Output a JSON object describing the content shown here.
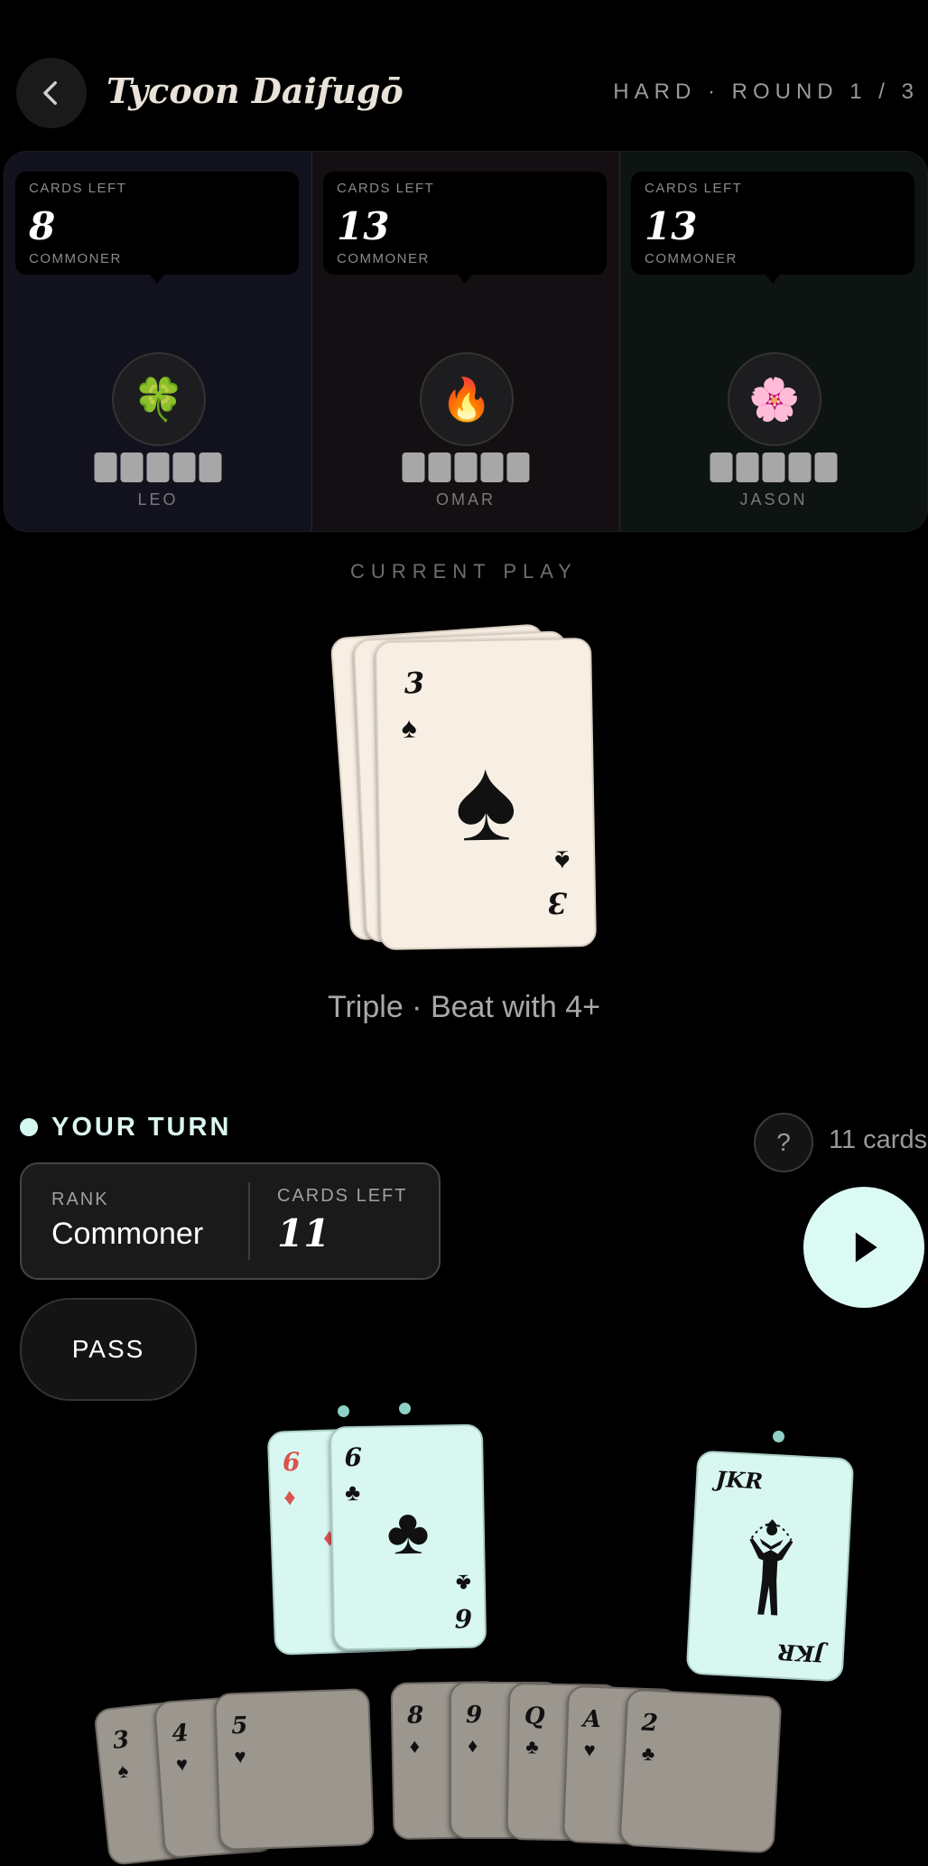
{
  "header": {
    "title": "Tycoon Daifugō",
    "round_info": "HARD · ROUND 1 / 3",
    "back_icon": "chevron-left-icon"
  },
  "opponents": [
    {
      "name": "LEO",
      "cards_left_label": "CARDS LEFT",
      "cards_left": "8",
      "rank": "COMMONER",
      "avatar": "🍀",
      "color": "#12121f"
    },
    {
      "name": "OMAR",
      "cards_left_label": "CARDS LEFT",
      "cards_left": "13",
      "rank": "COMMONER",
      "avatar": "🔥",
      "color": "#140f12"
    },
    {
      "name": "JASON",
      "cards_left_label": "CARDS LEFT",
      "cards_left": "13",
      "rank": "COMMONER",
      "avatar": "🌸",
      "color": "#0e1411"
    }
  ],
  "current_play": {
    "label": "CURRENT PLAY",
    "card_rank": "3",
    "card_suit": "♠",
    "caption": "Triple · Beat with 4+"
  },
  "player": {
    "turn_label": "YOUR TURN",
    "rank_label": "RANK",
    "rank": "Commoner",
    "cards_left_label": "CARDS LEFT",
    "cards_left": "11",
    "help_label": "?",
    "card_count": "11 cards",
    "pass_label": "PASS",
    "play_icon": "play-icon"
  },
  "hand_selected": [
    {
      "rank": "6",
      "suit": "♦",
      "color": "#d9534f"
    },
    {
      "rank": "6",
      "suit": "♣",
      "color": "#111111"
    },
    {
      "rank": "JKR",
      "suit": "",
      "color": "#111111"
    }
  ],
  "hand_rest": [
    {
      "rank": "3",
      "suit": "♠"
    },
    {
      "rank": "4",
      "suit": "♥"
    },
    {
      "rank": "5",
      "suit": "♥"
    },
    {
      "rank": "8",
      "suit": "♦"
    },
    {
      "rank": "9",
      "suit": "♦"
    },
    {
      "rank": "Q",
      "suit": "♣"
    },
    {
      "rank": "A",
      "suit": "♥"
    },
    {
      "rank": "2",
      "suit": "♣"
    }
  ]
}
